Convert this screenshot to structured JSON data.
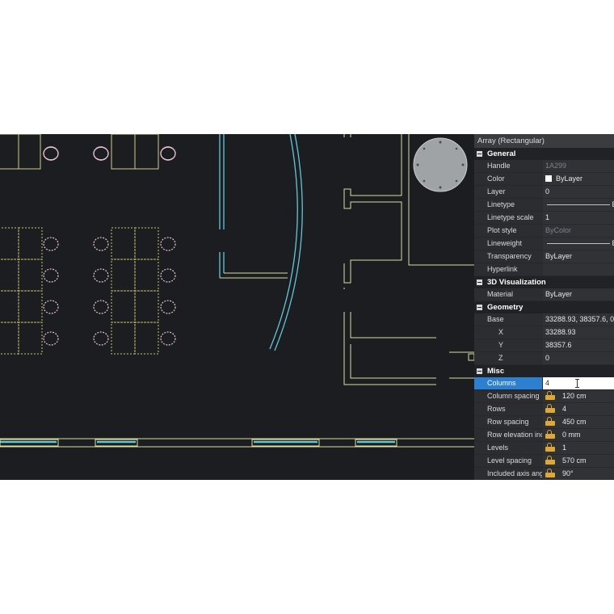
{
  "panel": {
    "title": "Array (Rectangular)",
    "sections": {
      "general": "General",
      "viz": "3D Visualization",
      "geometry": "Geometry",
      "misc": "Misc"
    },
    "general": [
      {
        "key": "Handle",
        "value": "1A299"
      },
      {
        "key": "Color",
        "value": "ByLayer"
      },
      {
        "key": "Layer",
        "value": "0"
      },
      {
        "key": "Linetype",
        "value": "B"
      },
      {
        "key": "Linetype scale",
        "value": "1"
      },
      {
        "key": "Plot style",
        "value": "ByColor"
      },
      {
        "key": "Lineweight",
        "value": "B"
      },
      {
        "key": "Transparency",
        "value": "ByLayer"
      },
      {
        "key": "Hyperlink",
        "value": ""
      }
    ],
    "viz": [
      {
        "key": "Material",
        "value": "ByLayer"
      }
    ],
    "geometry": [
      {
        "key": "Base",
        "value": "33288.93, 38357.6, 0"
      },
      {
        "key": "X",
        "value": "33288.93"
      },
      {
        "key": "Y",
        "value": "38357.6"
      },
      {
        "key": "Z",
        "value": "0"
      }
    ],
    "misc": [
      {
        "key": "Columns",
        "value": "4"
      },
      {
        "key": "Column spacing",
        "value": "120 cm"
      },
      {
        "key": "Rows",
        "value": "4"
      },
      {
        "key": "Row spacing",
        "value": "450 cm"
      },
      {
        "key": "Row elevation increment",
        "value": "0 mm"
      },
      {
        "key": "Levels",
        "value": "1"
      },
      {
        "key": "Level spacing",
        "value": "570 cm"
      },
      {
        "key": "Included axis angle",
        "value": "90°"
      }
    ]
  },
  "colors": {
    "canvas_bg": "#1b1d21",
    "wall_line": "#d9e0a0",
    "desk_dashed": "#c8c86e",
    "chair": "#e2c2d4",
    "glass": "#63c7d8",
    "column": "#9fa3a6"
  }
}
